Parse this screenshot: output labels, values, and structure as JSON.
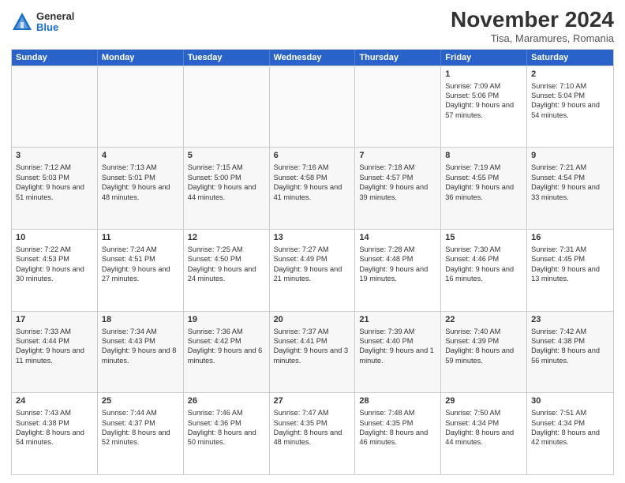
{
  "logo": {
    "general": "General",
    "blue": "Blue"
  },
  "title": "November 2024",
  "subtitle": "Tisa, Maramures, Romania",
  "days_of_week": [
    "Sunday",
    "Monday",
    "Tuesday",
    "Wednesday",
    "Thursday",
    "Friday",
    "Saturday"
  ],
  "rows": [
    [
      {
        "day": "",
        "info": ""
      },
      {
        "day": "",
        "info": ""
      },
      {
        "day": "",
        "info": ""
      },
      {
        "day": "",
        "info": ""
      },
      {
        "day": "",
        "info": ""
      },
      {
        "day": "1",
        "info": "Sunrise: 7:09 AM\nSunset: 5:06 PM\nDaylight: 9 hours and 57 minutes."
      },
      {
        "day": "2",
        "info": "Sunrise: 7:10 AM\nSunset: 5:04 PM\nDaylight: 9 hours and 54 minutes."
      }
    ],
    [
      {
        "day": "3",
        "info": "Sunrise: 7:12 AM\nSunset: 5:03 PM\nDaylight: 9 hours and 51 minutes."
      },
      {
        "day": "4",
        "info": "Sunrise: 7:13 AM\nSunset: 5:01 PM\nDaylight: 9 hours and 48 minutes."
      },
      {
        "day": "5",
        "info": "Sunrise: 7:15 AM\nSunset: 5:00 PM\nDaylight: 9 hours and 44 minutes."
      },
      {
        "day": "6",
        "info": "Sunrise: 7:16 AM\nSunset: 4:58 PM\nDaylight: 9 hours and 41 minutes."
      },
      {
        "day": "7",
        "info": "Sunrise: 7:18 AM\nSunset: 4:57 PM\nDaylight: 9 hours and 39 minutes."
      },
      {
        "day": "8",
        "info": "Sunrise: 7:19 AM\nSunset: 4:55 PM\nDaylight: 9 hours and 36 minutes."
      },
      {
        "day": "9",
        "info": "Sunrise: 7:21 AM\nSunset: 4:54 PM\nDaylight: 9 hours and 33 minutes."
      }
    ],
    [
      {
        "day": "10",
        "info": "Sunrise: 7:22 AM\nSunset: 4:53 PM\nDaylight: 9 hours and 30 minutes."
      },
      {
        "day": "11",
        "info": "Sunrise: 7:24 AM\nSunset: 4:51 PM\nDaylight: 9 hours and 27 minutes."
      },
      {
        "day": "12",
        "info": "Sunrise: 7:25 AM\nSunset: 4:50 PM\nDaylight: 9 hours and 24 minutes."
      },
      {
        "day": "13",
        "info": "Sunrise: 7:27 AM\nSunset: 4:49 PM\nDaylight: 9 hours and 21 minutes."
      },
      {
        "day": "14",
        "info": "Sunrise: 7:28 AM\nSunset: 4:48 PM\nDaylight: 9 hours and 19 minutes."
      },
      {
        "day": "15",
        "info": "Sunrise: 7:30 AM\nSunset: 4:46 PM\nDaylight: 9 hours and 16 minutes."
      },
      {
        "day": "16",
        "info": "Sunrise: 7:31 AM\nSunset: 4:45 PM\nDaylight: 9 hours and 13 minutes."
      }
    ],
    [
      {
        "day": "17",
        "info": "Sunrise: 7:33 AM\nSunset: 4:44 PM\nDaylight: 9 hours and 11 minutes."
      },
      {
        "day": "18",
        "info": "Sunrise: 7:34 AM\nSunset: 4:43 PM\nDaylight: 9 hours and 8 minutes."
      },
      {
        "day": "19",
        "info": "Sunrise: 7:36 AM\nSunset: 4:42 PM\nDaylight: 9 hours and 6 minutes."
      },
      {
        "day": "20",
        "info": "Sunrise: 7:37 AM\nSunset: 4:41 PM\nDaylight: 9 hours and 3 minutes."
      },
      {
        "day": "21",
        "info": "Sunrise: 7:39 AM\nSunset: 4:40 PM\nDaylight: 9 hours and 1 minute."
      },
      {
        "day": "22",
        "info": "Sunrise: 7:40 AM\nSunset: 4:39 PM\nDaylight: 8 hours and 59 minutes."
      },
      {
        "day": "23",
        "info": "Sunrise: 7:42 AM\nSunset: 4:38 PM\nDaylight: 8 hours and 56 minutes."
      }
    ],
    [
      {
        "day": "24",
        "info": "Sunrise: 7:43 AM\nSunset: 4:38 PM\nDaylight: 8 hours and 54 minutes."
      },
      {
        "day": "25",
        "info": "Sunrise: 7:44 AM\nSunset: 4:37 PM\nDaylight: 8 hours and 52 minutes."
      },
      {
        "day": "26",
        "info": "Sunrise: 7:46 AM\nSunset: 4:36 PM\nDaylight: 8 hours and 50 minutes."
      },
      {
        "day": "27",
        "info": "Sunrise: 7:47 AM\nSunset: 4:35 PM\nDaylight: 8 hours and 48 minutes."
      },
      {
        "day": "28",
        "info": "Sunrise: 7:48 AM\nSunset: 4:35 PM\nDaylight: 8 hours and 46 minutes."
      },
      {
        "day": "29",
        "info": "Sunrise: 7:50 AM\nSunset: 4:34 PM\nDaylight: 8 hours and 44 minutes."
      },
      {
        "day": "30",
        "info": "Sunrise: 7:51 AM\nSunset: 4:34 PM\nDaylight: 8 hours and 42 minutes."
      }
    ]
  ]
}
